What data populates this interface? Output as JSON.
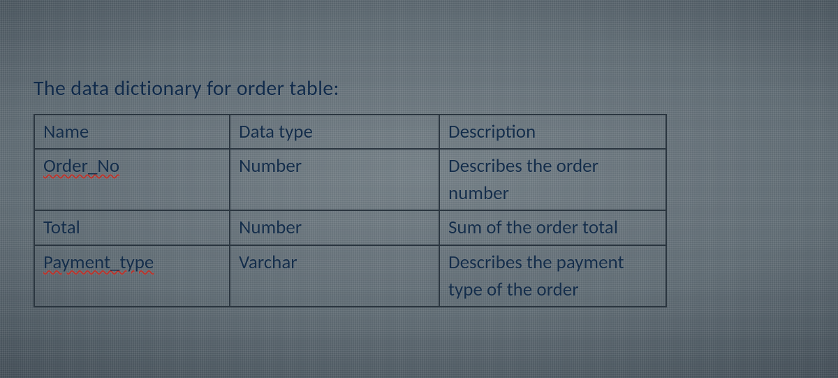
{
  "title": "The data dictionary for order table:",
  "table": {
    "headers": {
      "name": "Name",
      "datatype": "Data type",
      "description": "Description"
    },
    "rows": [
      {
        "name": "Order_No",
        "datatype": "Number",
        "description": "Describes the order number"
      },
      {
        "name": "Total",
        "datatype": "Number",
        "description": "Sum of the order total"
      },
      {
        "name": "Payment_type",
        "datatype": "Varchar",
        "description": "Describes the payment type of the order"
      }
    ]
  }
}
